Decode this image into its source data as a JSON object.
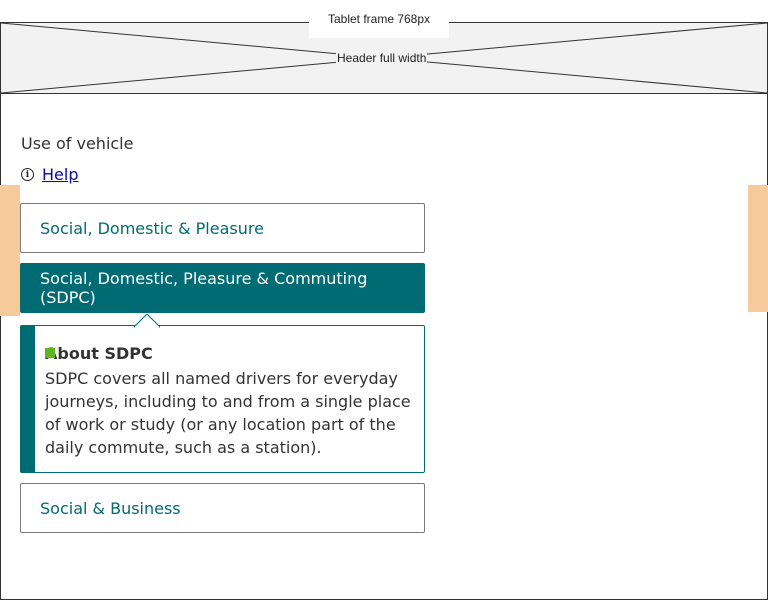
{
  "frame": {
    "label": "Tablet frame 768px"
  },
  "header": {
    "placeholder_label": "Header full width"
  },
  "field": {
    "label": "Use of vehicle"
  },
  "help": {
    "label": "Help",
    "icon": "info-icon"
  },
  "options": [
    {
      "label": "Social, Domestic & Pleasure",
      "selected": false
    },
    {
      "label": "Social, Domestic, Pleasure & Commuting (SDPC)",
      "selected": true
    },
    {
      "label": "Social & Business",
      "selected": false
    }
  ],
  "info_panel": {
    "title": "About SDPC",
    "body": "SDPC covers all named drivers for everyday journeys, including to and from a single place of work or study (or any location part of the daily commute, such as a station)."
  },
  "colors": {
    "primary": "#006b73",
    "accent_bullet": "#5ab51f",
    "gutter": "#f7ca9b",
    "link": "#0a0aa0"
  }
}
